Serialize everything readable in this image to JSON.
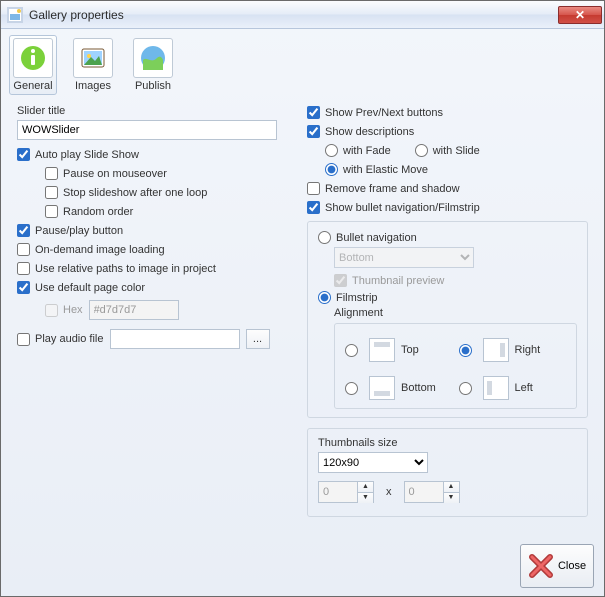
{
  "window": {
    "title": "Gallery properties"
  },
  "tabs": {
    "general": "General",
    "images": "Images",
    "publish": "Publish"
  },
  "left": {
    "slider_title_label": "Slider title",
    "slider_title_value": "WOWSlider",
    "auto_play": "Auto play Slide Show",
    "pause_mouseover": "Pause on mouseover",
    "stop_one_loop": "Stop slideshow after one loop",
    "random_order": "Random order",
    "pause_play": "Pause/play button",
    "on_demand": "On-demand image loading",
    "use_relative": "Use relative paths to image in project",
    "use_default_color": "Use default page color",
    "hex_label": "Hex",
    "hex_value": "#d7d7d7",
    "play_audio": "Play audio file",
    "audio_value": "",
    "browse": "..."
  },
  "right": {
    "show_prevnext": "Show Prev/Next buttons",
    "show_desc": "Show descriptions",
    "with_fade": "with Fade",
    "with_slide": "with Slide",
    "with_elastic": "with Elastic Move",
    "remove_frame": "Remove frame and shadow",
    "show_bullet": "Show bullet navigation/Filmstrip",
    "bullet_nav": "Bullet navigation",
    "bullet_pos": "Bottom",
    "thumb_preview": "Thumbnail preview",
    "filmstrip": "Filmstrip",
    "alignment": "Alignment",
    "align_top": "Top",
    "align_right": "Right",
    "align_bottom": "Bottom",
    "align_left": "Left",
    "thumbs_size_label": "Thumbnails size",
    "thumbs_size_value": "120x90",
    "dim_w": "0",
    "dim_sep": "x",
    "dim_h": "0"
  },
  "footer": {
    "close": "Close"
  }
}
